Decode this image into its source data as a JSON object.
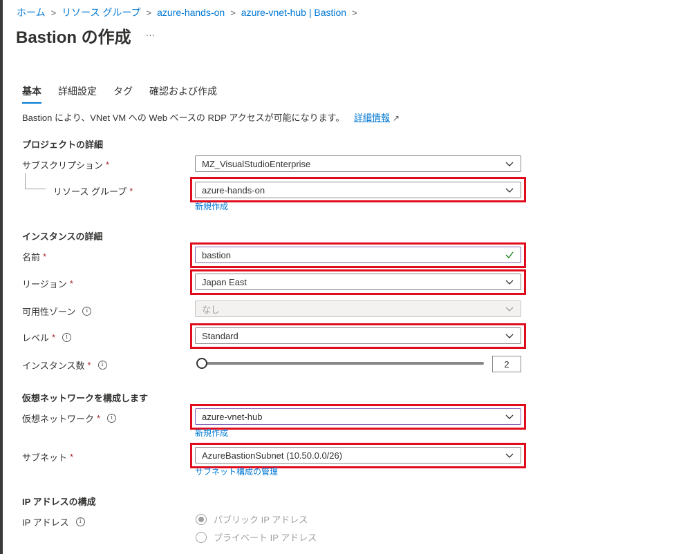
{
  "breadcrumb": [
    "ホーム",
    "リソース グループ",
    "azure-hands-on",
    "azure-vnet-hub | Bastion"
  ],
  "page": {
    "title": "Bastion の作成",
    "more": "..."
  },
  "tabs": [
    "基本",
    "詳細設定",
    "タグ",
    "確認および作成"
  ],
  "description": {
    "text": "Bastion により、VNet VM への Web ベースの RDP アクセスが可能になります。",
    "link": "詳細情報"
  },
  "sections": {
    "project": "プロジェクトの詳細",
    "instance": "インスタンスの詳細",
    "vnet": "仮想ネットワークを構成します",
    "ip": "IP アドレスの構成"
  },
  "fields": {
    "subscription": {
      "label": "サブスクリプション",
      "value": "MZ_VisualStudioEnterprise"
    },
    "resource_group": {
      "label": "リソース グループ",
      "value": "azure-hands-on",
      "create_new": "新規作成"
    },
    "name": {
      "label": "名前",
      "value": "bastion"
    },
    "region": {
      "label": "リージョン",
      "value": "Japan East"
    },
    "availability_zone": {
      "label": "可用性ゾーン",
      "value": "なし"
    },
    "tier": {
      "label": "レベル",
      "value": "Standard"
    },
    "instance_count": {
      "label": "インスタンス数",
      "value": "2",
      "slider_fraction": 0.0
    },
    "virtual_network": {
      "label": "仮想ネットワーク",
      "value": "azure-vnet-hub",
      "create_new": "新規作成"
    },
    "subnet": {
      "label": "サブネット",
      "value": "AzureBastionSubnet (10.50.0.0/26)",
      "manage": "サブネット構成の管理"
    },
    "ip_address": {
      "label": "IP アドレス",
      "options": [
        "パブリック IP アドレス",
        "プライベート IP アドレス"
      ],
      "selected": 0
    }
  },
  "required_mark": "*",
  "colors": {
    "accent": "#0078d4",
    "highlight": "#e00b1c",
    "required": "#a4262c",
    "valid": "#107c10"
  }
}
